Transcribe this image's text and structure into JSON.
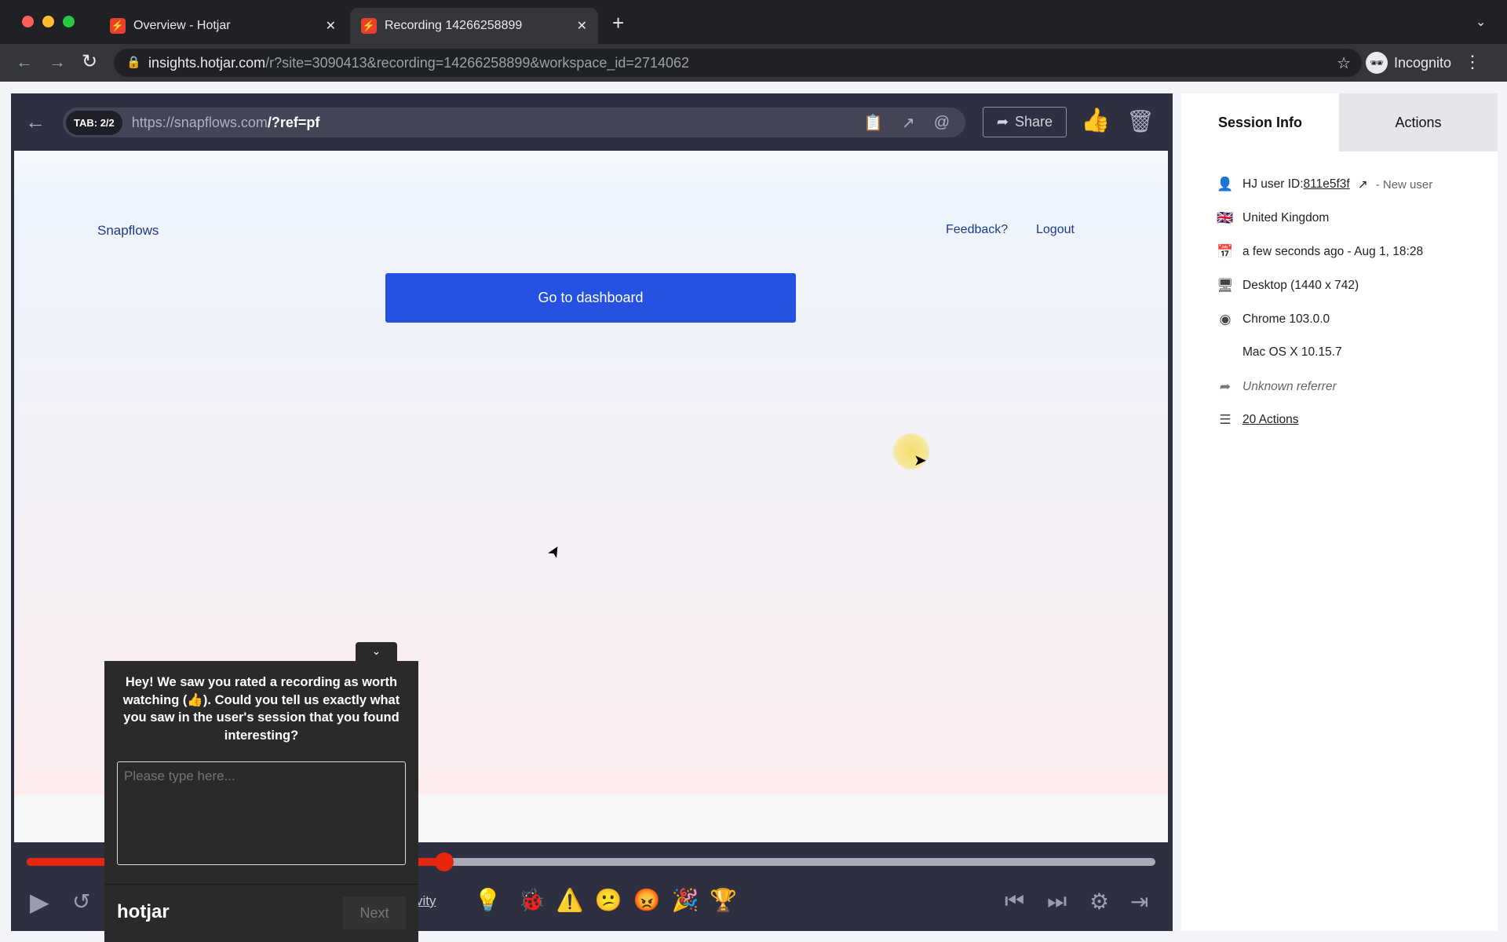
{
  "browser": {
    "tabs": [
      {
        "title": "Overview - Hotjar"
      },
      {
        "title": "Recording 14266258899"
      }
    ],
    "url_host": "insights.hotjar.com",
    "url_rest": "/r?site=3090413&recording=14266258899&workspace_id=2714062",
    "profile": "Incognito"
  },
  "player": {
    "tab_badge": "TAB: 2/2",
    "url_base": "https://snapflows.com",
    "url_path": "/?ref=pf",
    "share_label": "Share",
    "progress_fraction": 0.37
  },
  "site": {
    "brand": "Snapflows",
    "feedback": "Feedback?",
    "logout": "Logout",
    "cta": "Go to dashboard"
  },
  "session": {
    "tabs": [
      "Session Info",
      "Actions"
    ],
    "user_label": "HJ user ID: ",
    "user_id": "811e5f3f",
    "user_status": "- New user",
    "country": "United Kingdom",
    "time": "a few seconds ago - Aug 1, 18:28",
    "device": "Desktop (1440 x 742)",
    "browser": "Chrome 103.0.0",
    "os": "Mac OS X 10.15.7",
    "referrer": "Unknown referrer",
    "actions": "20 Actions"
  },
  "survey": {
    "question": "Hey! We saw you rated a recording as worth watching (👍). Could you tell us exactly what you saw in the user's session that you found interesting?",
    "placeholder": "Please type here...",
    "logo": "hotjar",
    "next": "Next"
  },
  "controls": {
    "activity_partial": "vity",
    "emojis": [
      "🐞",
      "⚠️",
      "😕",
      "😡",
      "🎉",
      "🏆"
    ]
  }
}
